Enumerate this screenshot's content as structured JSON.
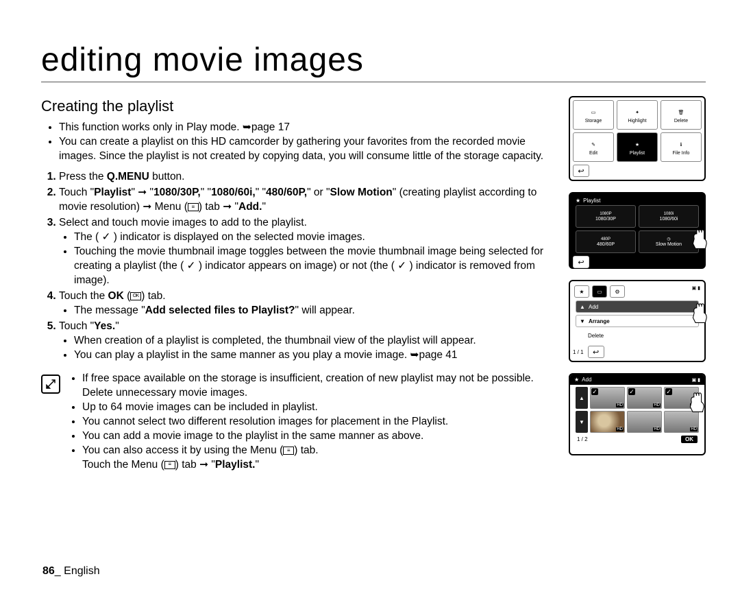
{
  "title": "editing movie images",
  "subtitle": "Creating the playlist",
  "intro": [
    "This function works only in Play mode. ➥page 17",
    "You can create a playlist on this HD camcorder by gathering your favorites from the recorded movie images. Since the playlist is not created by copying data, you will consume little of the storage capacity."
  ],
  "steps": {
    "s1": {
      "prefix": "Press the ",
      "bold": "Q.MENU",
      "suffix": " button."
    },
    "s2": {
      "a": "Touch \"",
      "b1": "Playlist",
      "arrow1": "\" ➞ \"",
      "b2": "1080/30P,",
      "mid1": "\" \"",
      "b3": "1080/60i,",
      "mid2": "\" \"",
      "b4": "480/60P,",
      "mid3": "\" or \"",
      "b5": "Slow Motion",
      "c": "\" (creating playlist according to movie resolution) ➞ Menu (",
      "d": ") tab ➞ \"",
      "b6": "Add.",
      "e": "\""
    },
    "s3": {
      "line": "Select and touch movie images to add to the playlist.",
      "sub": [
        "The ( ✓ ) indicator is displayed on the selected movie images.",
        "Touching the movie thumbnail image toggles between the movie thumbnail image being selected for creating a playlist (the ( ✓ ) indicator appears on image) or not (the ( ✓ ) indicator is removed from image)."
      ]
    },
    "s4": {
      "a": "Touch the ",
      "b": "OK",
      "c": " (",
      "d": ") tab.",
      "sub_a": "The message \"",
      "sub_b": "Add selected files to Playlist?",
      "sub_c": "\" will appear."
    },
    "s5": {
      "a": "Touch \"",
      "b": "Yes.",
      "c": "\"",
      "sub": [
        "When creation of a playlist is completed, the thumbnail view of the playlist will appear.",
        "You can play a playlist in the same manner as you play a movie image. ➥page 41"
      ]
    }
  },
  "notes": {
    "n1": "If free space available on the storage is insufficient, creation of new playlist may not be possible. Delete unnecessary movie images.",
    "n2": "Up to 64 movie images can be included in playlist.",
    "n3": "You cannot select two different resolution images for placement in the Playlist.",
    "n4": "You can add a movie image to the playlist in the same manner as above.",
    "n5a": "You can also access it by using the Menu (",
    "n5b": ") tab.",
    "n6a": "Touch the Menu (",
    "n6b": ") tab ➞ \"",
    "n6c": "Playlist.",
    "n6d": "\""
  },
  "footer": {
    "num": "86",
    "sep": "_ ",
    "lang": "English"
  },
  "screens": {
    "s1": {
      "cells": [
        "Storage",
        "Highlight",
        "Delete",
        "Edit",
        "Playlist",
        "File Info"
      ]
    },
    "s2": {
      "title": "Playlist",
      "cells": [
        "1080/30P",
        "1080/60i",
        "480/60P",
        "Slow Motion"
      ]
    },
    "s3": {
      "rows": [
        "Add",
        "Arrange",
        "Delete"
      ],
      "page": "1 / 1"
    },
    "s4": {
      "title": "Add",
      "page": "1 / 2",
      "ok": "OK"
    }
  }
}
